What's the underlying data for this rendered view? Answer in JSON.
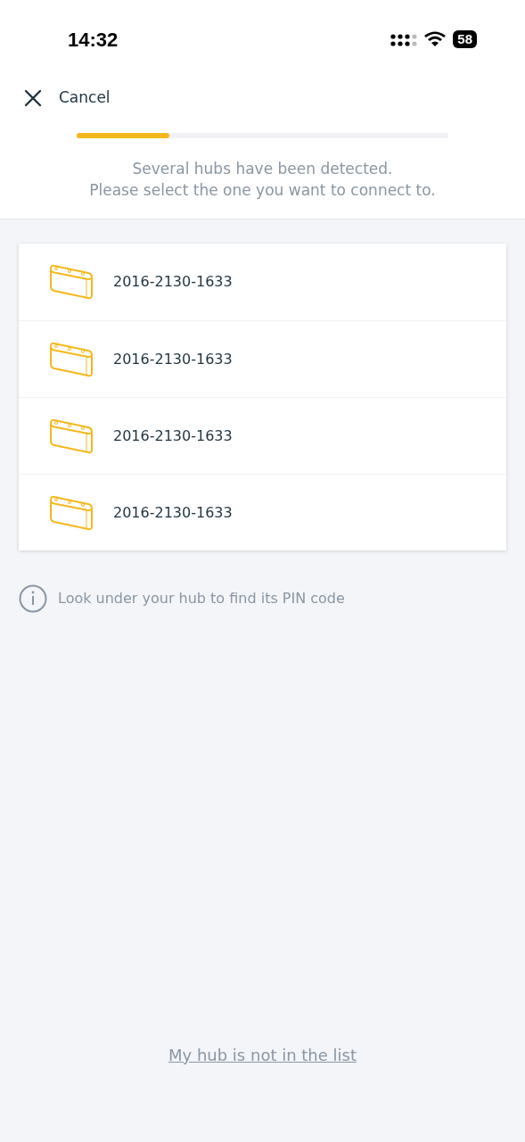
{
  "status_bar": {
    "time": "14:32",
    "battery": "58"
  },
  "header": {
    "cancel": "Cancel",
    "progress": {
      "level": 0.25
    },
    "message": [
      "Several hubs have been detected.",
      "Please select the one you want to connect to."
    ]
  },
  "hubs": [
    {
      "name": "2016-2130-1633"
    },
    {
      "name": "2016-2130-1633"
    },
    {
      "name": "2016-2130-1633"
    },
    {
      "name": "2016-2130-1633"
    }
  ],
  "info": "Look under your hub to find its PIN code",
  "footer_link": "My hub is not in the list"
}
